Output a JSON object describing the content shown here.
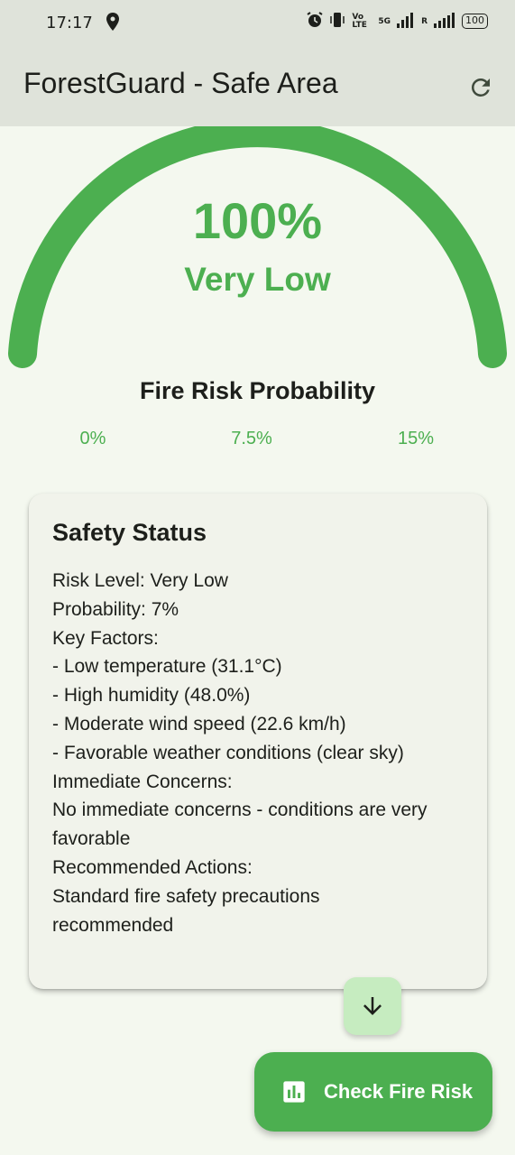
{
  "status_bar": {
    "time": "17:17",
    "network": "5G",
    "volte": "Vo LTE",
    "roaming": "R",
    "battery": "100"
  },
  "app_bar": {
    "title": "ForestGuard - Safe Area",
    "refresh_icon": "refresh-icon"
  },
  "gauge": {
    "percent_text": "100%",
    "fraction_filled": 1.0,
    "level": "Very Low",
    "caption": "Fire Risk Probability",
    "ticks": [
      "0%",
      "7.5%",
      "15%"
    ],
    "color": "#4caf50"
  },
  "safety_card": {
    "title": "Safety Status",
    "lines": [
      "Risk Level: Very Low",
      "Probability: 7%",
      "Key Factors:",
      "- Low temperature (31.1°C)",
      "- High humidity (48.0%)",
      "- Moderate wind speed (22.6 km/h)",
      "- Favorable weather conditions (clear sky)",
      "Immediate Concerns:",
      "No immediate concerns - conditions are very",
      "favorable",
      "Recommended Actions:",
      "Standard fire safety precautions",
      "recommended"
    ]
  },
  "scroll_button": {
    "icon": "arrow-down-icon"
  },
  "fab": {
    "label": "Check Fire Risk",
    "icon": "bar-chart-icon",
    "color": "#4caf50"
  }
}
